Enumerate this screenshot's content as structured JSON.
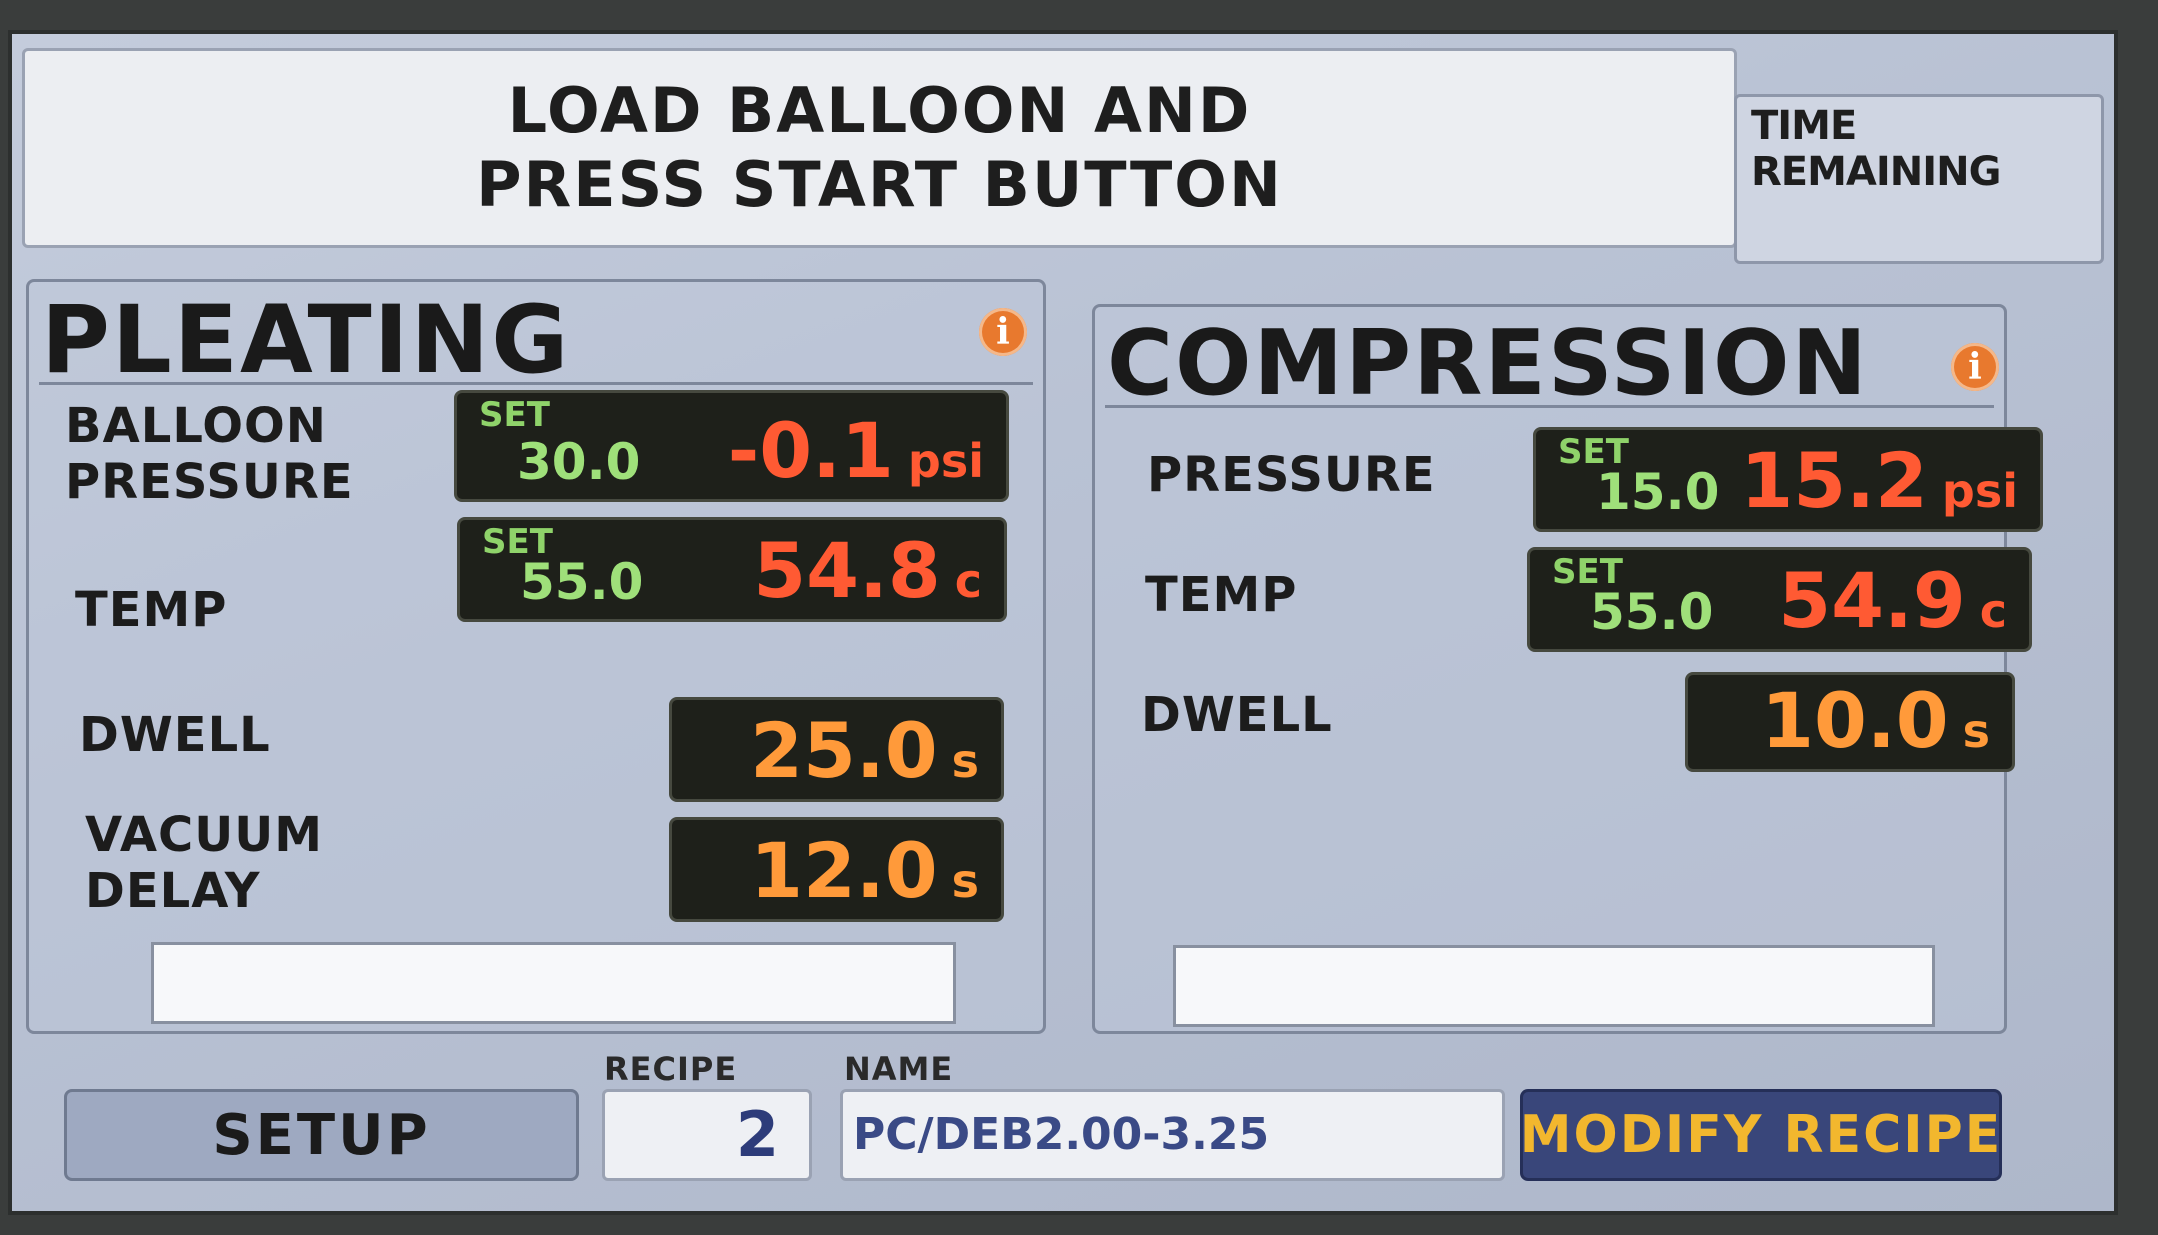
{
  "message": {
    "line1": "LOAD BALLOON AND",
    "line2": "PRESS START BUTTON"
  },
  "time_remaining": {
    "label": "TIME REMAINING",
    "value": ""
  },
  "pleating": {
    "title": "PLEATING",
    "info_icon": "i",
    "balloon_pressure": {
      "label_line1": "BALLOON",
      "label_line2": "PRESSURE",
      "set_label": "SET",
      "set_value": "30.0",
      "actual": "-0.1",
      "unit": "psi"
    },
    "temp": {
      "label": "TEMP",
      "set_label": "SET",
      "set_value": "55.0",
      "actual": "54.8",
      "unit": "c"
    },
    "dwell": {
      "label": "DWELL",
      "value": "25.0",
      "unit": "s"
    },
    "vacuum_delay": {
      "label_line1": "VACUUM",
      "label_line2": "DELAY",
      "value": "12.0",
      "unit": "s"
    },
    "status_field": ""
  },
  "compression": {
    "title": "COMPRESSION",
    "info_icon": "i",
    "pressure": {
      "label": "PRESSURE",
      "set_label": "SET",
      "set_value": "15.0",
      "actual": "15.2",
      "unit": "psi"
    },
    "temp": {
      "label": "TEMP",
      "set_label": "SET",
      "set_value": "55.0",
      "actual": "54.9",
      "unit": "c"
    },
    "dwell": {
      "label": "DWELL",
      "value": "10.0",
      "unit": "s"
    },
    "status_field": ""
  },
  "footer": {
    "setup_label": "SETUP",
    "recipe_label": "RECIPE",
    "recipe_value": "2",
    "name_label": "NAME",
    "name_value": "PC/DEB2.00-3.25",
    "modify_label": "MODIFY RECIPE"
  },
  "colors": {
    "accent_button": "#39467a",
    "accent_text": "#f2b72e",
    "actual_value": "#ff5a33",
    "dwell_value": "#ff9a3a",
    "set_value": "#9fe07a",
    "info_icon": "#e8792e"
  }
}
